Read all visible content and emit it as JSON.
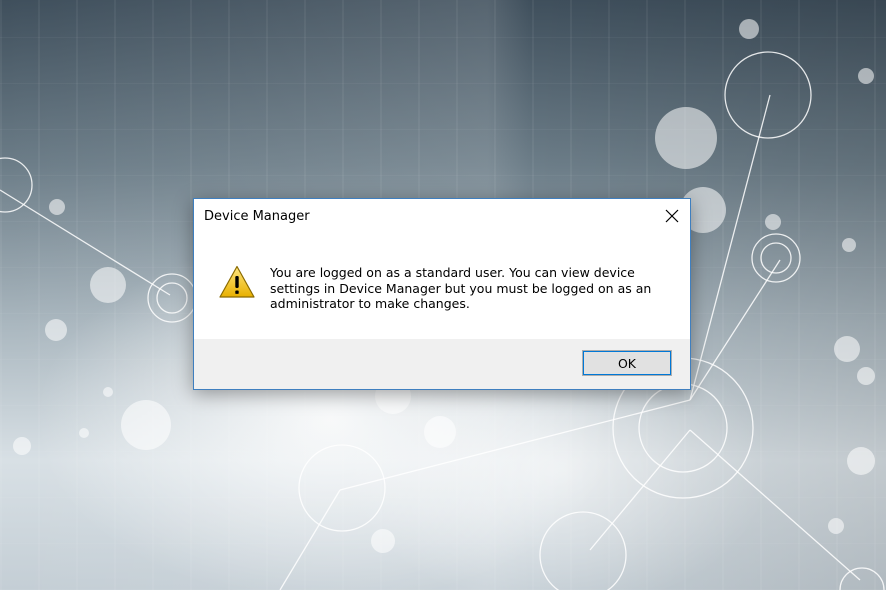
{
  "dialog": {
    "title": "Device Manager",
    "message": "You are logged on as a standard user. You can view device settings in Device Manager but you must be logged on as an administrator to make changes.",
    "icon": "warning-icon",
    "ok_label": "OK",
    "close_icon": "close-icon"
  },
  "colors": {
    "dialog_border": "#3f7fbf",
    "footer_bg": "#f0f0f0",
    "button_focus": "#0078d7",
    "warning_yellow": "#f4c430"
  }
}
